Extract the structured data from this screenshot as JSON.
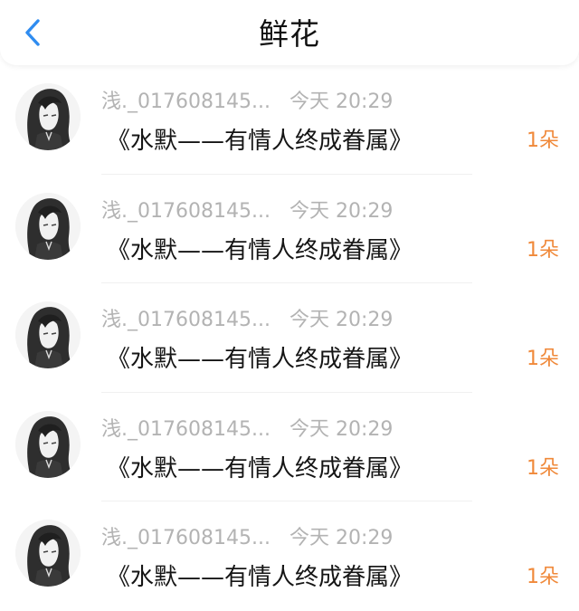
{
  "header": {
    "title": "鲜花",
    "back_icon": "chevron-left-icon",
    "accent_color": "#2f8cf0"
  },
  "records": [
    {
      "user": "浅._017608145...",
      "time": "今天 20:29",
      "gift": "《水默——有情人终成眷属》",
      "count": "1朵"
    },
    {
      "user": "浅._017608145...",
      "time": "今天 20:29",
      "gift": "《水默——有情人终成眷属》",
      "count": "1朵"
    },
    {
      "user": "浅._017608145...",
      "time": "今天 20:29",
      "gift": "《水默——有情人终成眷属》",
      "count": "1朵"
    },
    {
      "user": "浅._017608145...",
      "time": "今天 20:29",
      "gift": "《水默——有情人终成眷属》",
      "count": "1朵"
    },
    {
      "user": "浅._017608145...",
      "time": "今天 20:29",
      "gift": "《水默——有情人终成眷属》",
      "count": "1朵"
    }
  ],
  "colors": {
    "meta_text": "#b3b3b3",
    "count_text": "#f0893a",
    "gift_text": "#151515"
  }
}
